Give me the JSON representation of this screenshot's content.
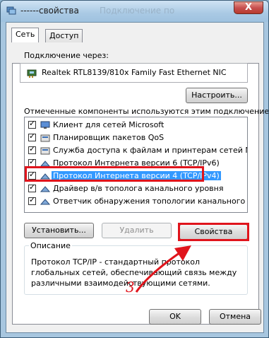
{
  "window": {
    "title": "------свойства",
    "title_ghost": "Подключение по",
    "close_label": "X"
  },
  "tabs": [
    {
      "label": "Сеть",
      "active": true
    },
    {
      "label": "Доступ",
      "active": false
    }
  ],
  "connection": {
    "label": "Подключение через:",
    "adapter": "Realtek RTL8139/810x Family Fast Ethernet NIC",
    "configure_label": "Настроить..."
  },
  "components": {
    "label": "Отмеченные компоненты используются этим подключением:",
    "items": [
      {
        "label": "Клиент для сетей Microsoft",
        "checked": true,
        "icon": "client-icon"
      },
      {
        "label": "Планировщик пакетов QoS",
        "checked": true,
        "icon": "service-icon"
      },
      {
        "label": "Служба доступа к файлам и принтерам сетей Micro...",
        "checked": true,
        "icon": "service-icon"
      },
      {
        "label": "Протокол Интернета версии 6 (TCP/IPv6)",
        "checked": true,
        "icon": "protocol-icon"
      },
      {
        "label": "Протокол Интернета версии 4 (TCP/IPv4)",
        "checked": true,
        "icon": "protocol-icon",
        "selected": true
      },
      {
        "label": "Драйвер в/в тополога канального уровня",
        "checked": true,
        "icon": "protocol-icon"
      },
      {
        "label": "Ответчик обнаружения топологии канального уровня",
        "checked": true,
        "icon": "protocol-icon"
      }
    ]
  },
  "actions": {
    "install": "Установить...",
    "remove": "Удалить",
    "properties": "Свойства"
  },
  "description": {
    "label": "Описание",
    "text": "Протокол TCP/IP - стандартный протокол глобальных сетей, обеспечивающий связь между различными взаимодействующими сетями."
  },
  "footer": {
    "ok": "OK",
    "cancel": "Отмена"
  },
  "annotation": {
    "step_number": "3",
    "color": "#e0141c"
  }
}
